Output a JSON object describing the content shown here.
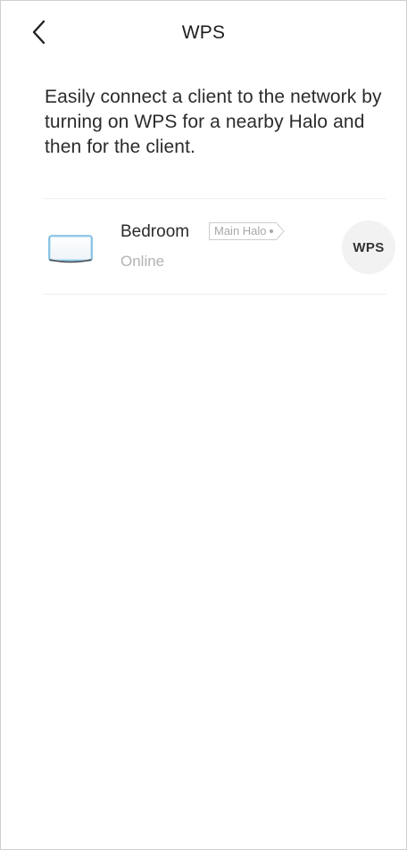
{
  "header": {
    "title": "WPS",
    "back_icon": "chevron-left-icon"
  },
  "description": "Easily connect a client to the network by turning on WPS for a nearby Halo and then for the client.",
  "devices": [
    {
      "name": "Bedroom",
      "tag": "Main Halo",
      "status": "Online",
      "icon": "halo-device-icon",
      "action_label": "WPS"
    }
  ],
  "colors": {
    "device_icon_outline": "#5aaad6",
    "status_text": "#b3b3b3",
    "wps_button_bg": "#f2f2f2"
  }
}
